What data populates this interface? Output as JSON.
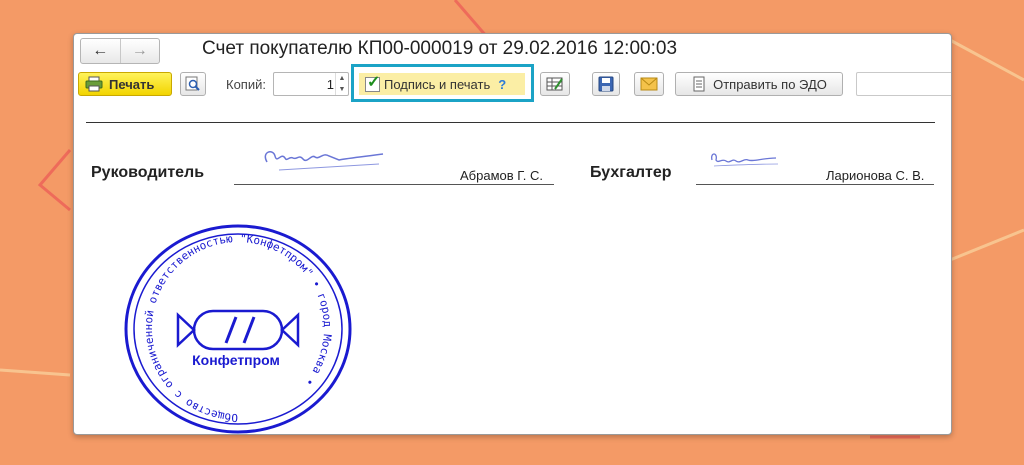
{
  "colors": {
    "background": "#f49a66",
    "accent": "#1ba3c6",
    "print_button": "#f6df1a",
    "stamp": "#1a1ad0"
  },
  "nav": {
    "back_icon": "arrow-left-icon",
    "forward_icon": "arrow-right-icon"
  },
  "window": {
    "title": "Счет покупателю КП00-000019 от 29.02.2016 12:00:03"
  },
  "toolbar": {
    "print_label": "Печать",
    "copies_label": "Копий:",
    "copies_value": "1",
    "sign_checkbox_label": "Подпись и печать",
    "sign_checkbox_checked": true,
    "help_mark": "?",
    "send_edo_label": "Отправить по ЭДО"
  },
  "document": {
    "director_title": "Руководитель",
    "director_name": "Абрамов Г. С.",
    "accountant_title": "Бухгалтер",
    "accountant_name": "Ларионова С. В.",
    "stamp": {
      "ring_text": "Общество с ограниченной ответственностью \"Конфетпром\" • город Москва •",
      "center_text": "Конфетпром"
    }
  }
}
